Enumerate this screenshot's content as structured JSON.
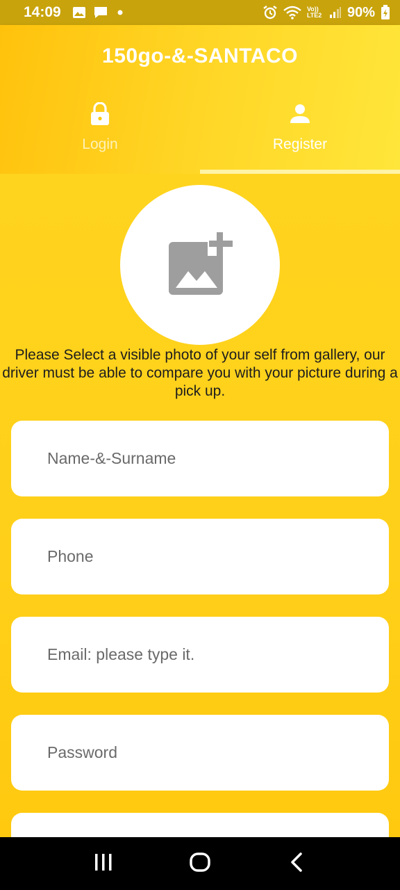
{
  "status_bar": {
    "time": "14:09",
    "battery": "90%",
    "network_label": "Vo)) LTE2",
    "icons": [
      "gallery-icon",
      "message-icon",
      "dot-icon",
      "alarm-icon",
      "wifi-icon",
      "signal-icon",
      "battery-icon"
    ]
  },
  "header": {
    "title": "150go-&-SANTACO",
    "tabs": [
      {
        "label": "Login",
        "icon": "lock-icon",
        "selected": false
      },
      {
        "label": "Register",
        "icon": "person-icon",
        "selected": true
      }
    ]
  },
  "register": {
    "photo_icon": "add-photo-icon",
    "instruction": "Please Select a visible photo of your self from gallery, our driver must be able to compare you with your picture during a pick up.",
    "fields": [
      {
        "placeholder": "Name-&-Surname",
        "value": ""
      },
      {
        "placeholder": "Phone",
        "value": ""
      },
      {
        "placeholder": "Email: please type it.",
        "value": ""
      },
      {
        "placeholder": "Password",
        "value": ""
      },
      {
        "placeholder": "",
        "value": ""
      }
    ]
  },
  "nav_bar": {
    "buttons": [
      "recents-icon",
      "home-icon",
      "back-icon"
    ]
  },
  "colors": {
    "accent": "#ffd21f",
    "status_bar": "#c8a30c",
    "photo_icon": "#9e9e9e"
  }
}
